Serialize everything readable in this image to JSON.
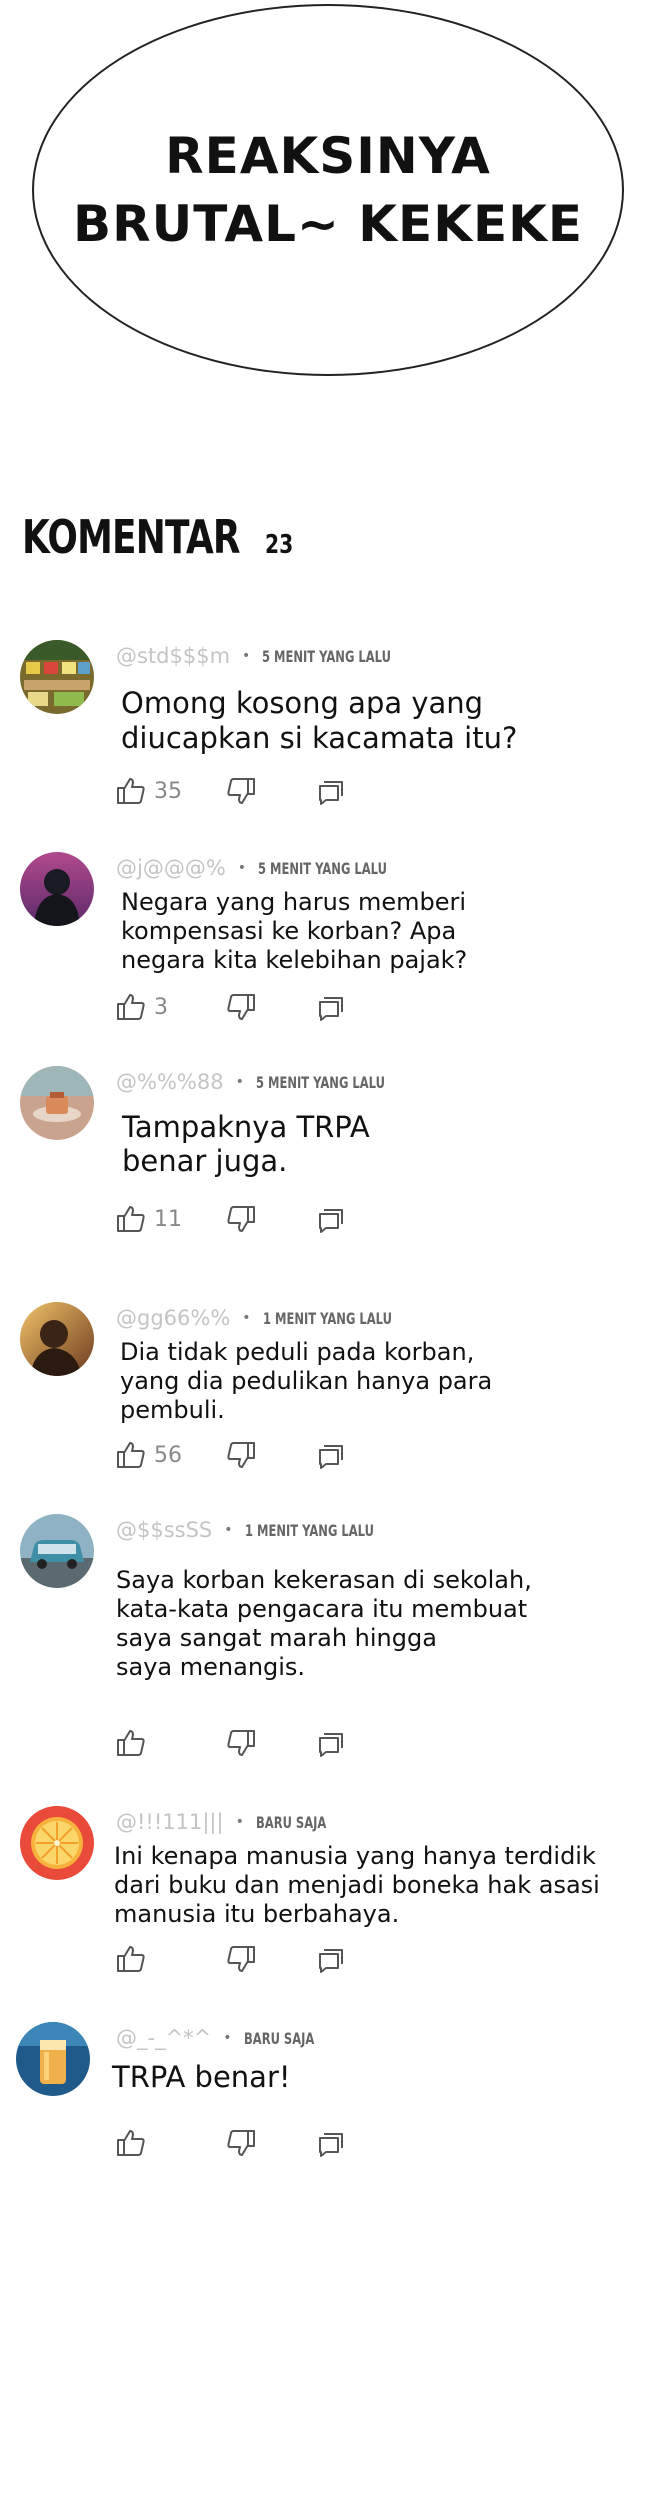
{
  "bubble": {
    "text": "REAKSINYA\nBRUTAL~ KEKEKE"
  },
  "header": {
    "title": "KOMENTAR",
    "count": "23"
  },
  "comments": [
    {
      "username": "@std$$$m",
      "time": "5 MENIT YANG LALU",
      "text": "Omong kosong apa yang\ndiucapkan si kacamata itu?",
      "likes": "35",
      "avatar": "avatar-market-icon"
    },
    {
      "username": "@j@@@%",
      "time": "5 MENIT YANG LALU",
      "text": "Negara yang harus memberi\nkompensasi ke korban? Apa\nnegara kita kelebihan pajak?",
      "likes": "3",
      "avatar": "avatar-hooded-figure-icon"
    },
    {
      "username": "@%%%88",
      "time": "5 MENIT YANG LALU",
      "text": "Tampaknya TRPA\nbenar juga.",
      "likes": "11",
      "avatar": "avatar-cafe-icon"
    },
    {
      "username": "@gg66%%",
      "time": "1 MENIT YANG LALU",
      "text": "Dia tidak peduli pada korban,\nyang dia pedulikan hanya para\npembuli.",
      "likes": "56",
      "avatar": "avatar-portrait-icon"
    },
    {
      "username": "@$$ssSS",
      "time": "1 MENIT YANG LALU",
      "text": "Saya korban kekerasan di sekolah,\nkata-kata pengacara itu membuat\nsaya sangat marah hingga\nsaya menangis.",
      "likes": "",
      "avatar": "avatar-car-icon"
    },
    {
      "username": "@!!!111|||",
      "time": "BARU SAJA",
      "text": "Ini kenapa manusia yang hanya  terdidik\ndari buku dan menjadi boneka hak asasi\nmanusia itu berbahaya.",
      "likes": "",
      "avatar": "avatar-orange-icon"
    },
    {
      "username": "@_-_^*^",
      "time": "BARU SAJA",
      "text": "TRPA benar!",
      "likes": "",
      "avatar": "avatar-drink-icon"
    }
  ],
  "colors": {
    "username": "#c4c4c4",
    "time": "#666666",
    "icon": "#555555"
  }
}
